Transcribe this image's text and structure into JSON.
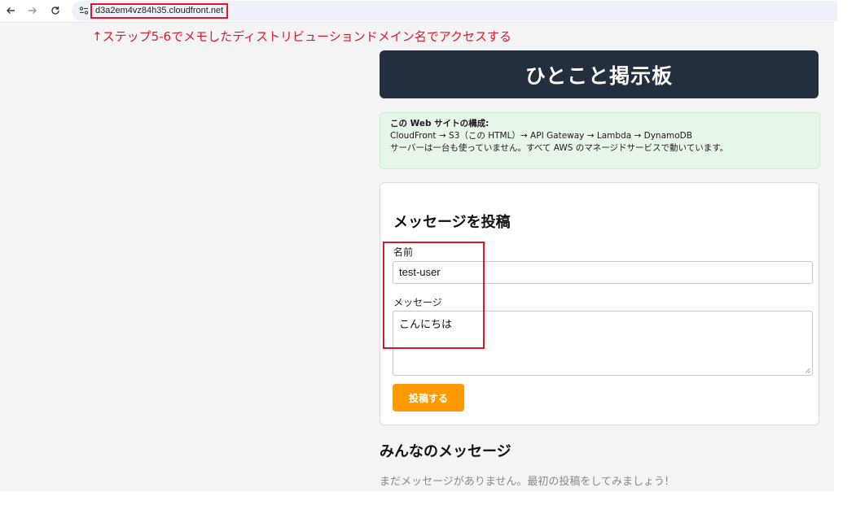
{
  "browser": {
    "url": "d3a2em4vz84h35.cloudfront.net",
    "icons": [
      "back-arrow-icon",
      "forward-arrow-icon",
      "reload-icon",
      "site-info-icon"
    ]
  },
  "annotation": {
    "text": "↑ステップ5-6でメモしたディストリビューションドメイン名でアクセスする",
    "color": "#e0162b"
  },
  "header": {
    "title": "ひとこと掲示板",
    "background": "#232f3e"
  },
  "info": {
    "heading": "この Web サイトの構成:",
    "architecture": "CloudFront → S3（この HTML）→ API Gateway → Lambda → DynamoDB",
    "note": "サーバーは一台も使っていません。すべて AWS のマネージドサービスで動いています。",
    "background": "#e8f5e9"
  },
  "form": {
    "title": "メッセージを投稿",
    "name_label": "名前",
    "name_value": "test-user",
    "message_label": "メッセージ",
    "message_value": "こんにちは",
    "submit_label": "投稿する",
    "submit_color": "#ff9900"
  },
  "messages": {
    "title": "みんなのメッセージ",
    "empty_text": "まだメッセージがありません。最初の投稿をしてみましょう!"
  }
}
